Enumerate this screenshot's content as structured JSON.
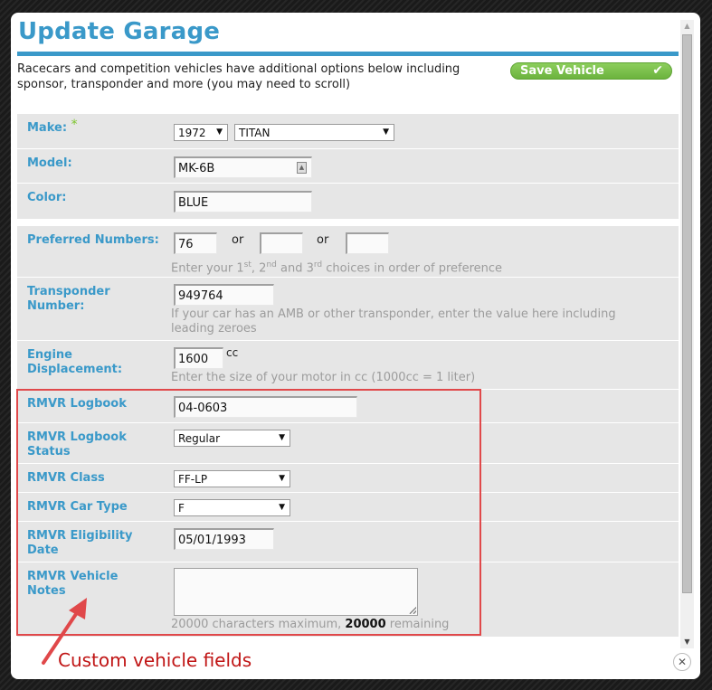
{
  "dialog": {
    "title": "Update Garage",
    "intro": "Racecars and competition vehicles have additional options below including sponsor, transponder and more (you may need to scroll)",
    "save_label": "Save Vehicle",
    "save_icon": "checkmark-icon",
    "close_icon": "close-icon",
    "accent_color": "#3a99c9",
    "save_color": "#7cc04a"
  },
  "fields": {
    "make": {
      "label": "Make:",
      "required_mark": "*",
      "year": "1972",
      "make": "TITAN"
    },
    "model": {
      "label": "Model:",
      "value": "MK-6B"
    },
    "color": {
      "label": "Color:",
      "value": "BLUE"
    },
    "preferred": {
      "label": "Preferred Numbers:",
      "first": "76",
      "second": "",
      "third": "",
      "or_label": "or",
      "hint_parts": [
        "Enter your 1",
        "st",
        ", 2",
        "nd",
        " and 3",
        "rd",
        " choices in order of preference"
      ]
    },
    "transponder": {
      "label": "Transponder Number:",
      "value": "949764",
      "hint": "If your car has an AMB or other transponder, enter the value here including leading zeroes"
    },
    "engine": {
      "label": "Engine Displacement:",
      "value": "1600",
      "unit": "cc",
      "hint": "Enter the size of your motor in cc (1000cc = 1 liter)"
    },
    "logbook": {
      "label": "RMVR Logbook",
      "value": "04-0603"
    },
    "logbook_status": {
      "label": "RMVR Logbook Status",
      "value": "Regular"
    },
    "class": {
      "label": "RMVR Class",
      "value": "FF-LP"
    },
    "car_type": {
      "label": "RMVR Car Type",
      "value": "F"
    },
    "eligibility": {
      "label": "RMVR Eligibility Date",
      "value": "05/01/1993"
    },
    "notes": {
      "label": "RMVR Vehicle Notes",
      "value": "",
      "counter_prefix": "20000 characters maximum, ",
      "counter_remaining": "20000",
      "counter_suffix": " remaining"
    }
  },
  "annotation": {
    "text": "Custom vehicle fields",
    "color": "#c01515",
    "highlight_color": "#e0484a"
  }
}
